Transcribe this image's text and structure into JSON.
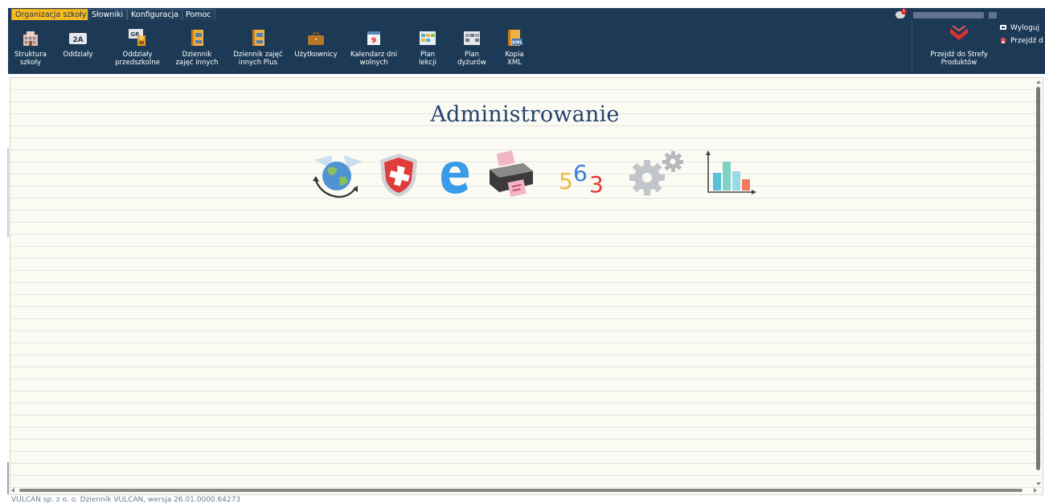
{
  "menu": {
    "tabs": [
      {
        "label": "Organizacja szkoły",
        "active": true
      },
      {
        "label": "Słowniki",
        "active": false
      },
      {
        "label": "Konfiguracja",
        "active": false
      },
      {
        "label": "Pomoc",
        "active": false
      }
    ]
  },
  "user": {
    "notification_count": "1"
  },
  "toolbar": {
    "items": [
      {
        "label": "Struktura\nszkoły",
        "icon": "building-icon"
      },
      {
        "label": "Oddziały",
        "icon": "class-2a-icon"
      },
      {
        "label": "Oddziały\nprzedszkolne",
        "icon": "preschool-group-icon"
      },
      {
        "label": "Dziennik\nzajęć innych",
        "icon": "journal-icon"
      },
      {
        "label": "Dziennik zajęć\ninnych Plus",
        "icon": "journal-plus-icon"
      },
      {
        "label": "Użytkownicy",
        "icon": "briefcase-icon"
      },
      {
        "label": "Kalendarz dni\nwolnych",
        "icon": "calendar-icon"
      },
      {
        "label": "Plan\nlekcji",
        "icon": "lesson-plan-icon"
      },
      {
        "label": "Plan\ndyżurów",
        "icon": "duty-plan-icon"
      },
      {
        "label": "Kopia\nXML",
        "icon": "xml-copy-icon"
      }
    ]
  },
  "right_panel": {
    "strefa_label": "Przejdź do Strefy\nProduktów",
    "logout_label": "Wyloguj",
    "goto_label": "Przejdź d"
  },
  "main": {
    "title": "Administrowanie",
    "modules": [
      {
        "icon": "globe-exchange-icon"
      },
      {
        "icon": "security-shield-icon"
      },
      {
        "icon": "e-letter-icon"
      },
      {
        "icon": "printer-icon"
      },
      {
        "icon": "numbers-563-icon"
      },
      {
        "icon": "gears-icon"
      },
      {
        "icon": "bar-chart-icon"
      }
    ]
  },
  "footer": {
    "text": "VULCAN sp. z o. o. Dziennik VULCAN, wersja 26.01.0000.64273"
  },
  "colors": {
    "header_bg": "#1c3a56",
    "active_tab": "#f4bb22",
    "title": "#25426d"
  }
}
